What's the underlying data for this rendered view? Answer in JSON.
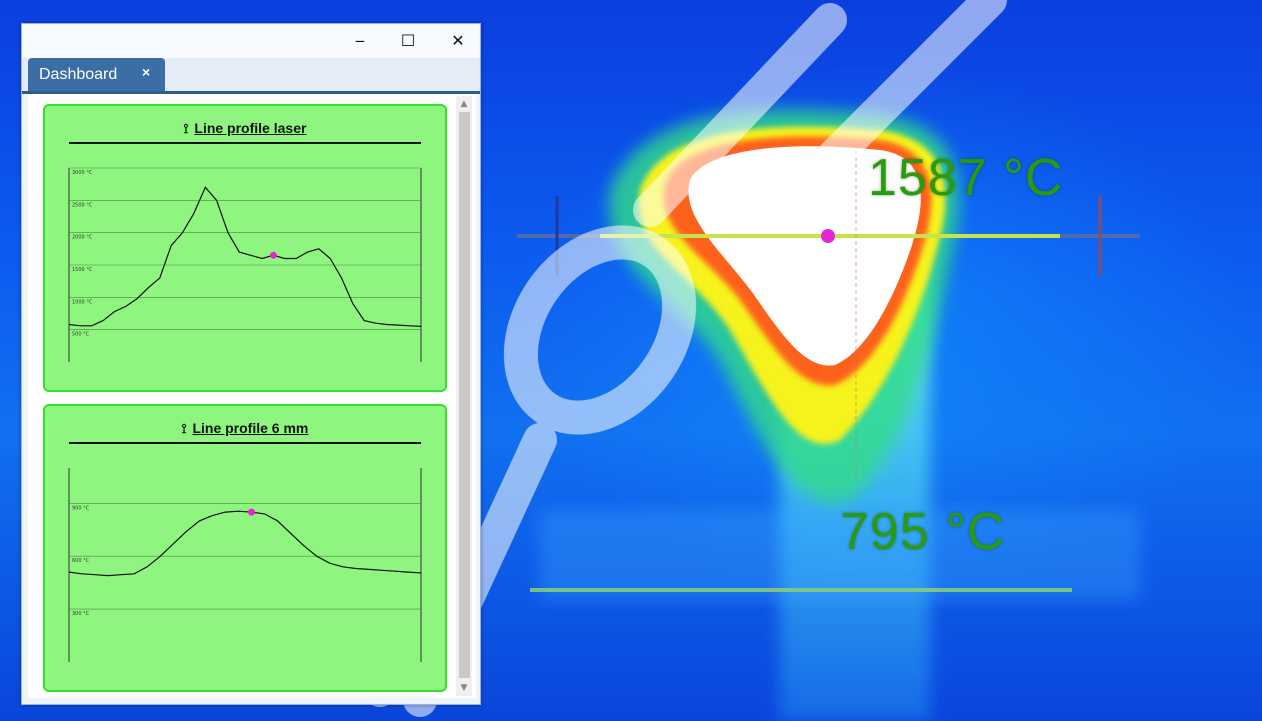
{
  "window": {
    "minimize_label": "‒",
    "maximize_label": "☐",
    "close_label": "✕"
  },
  "tabs": [
    {
      "label": "Dashboard",
      "close_label": "×"
    }
  ],
  "thermal_view": {
    "max_temp_label": "1587 °C",
    "min_temp_label": "795 °C"
  },
  "colors": {
    "panel_fill": "#8ef57f",
    "panel_border": "#35e02d",
    "marker": "#e626d6",
    "tab": "#3a6ea5",
    "temp_label": "#2b9a10"
  },
  "panels": [
    {
      "title": "Line profile laser",
      "icon": "line-profile-icon"
    },
    {
      "title": "Line profile 6 mm",
      "icon": "line-profile-icon"
    }
  ],
  "chart_data": [
    {
      "type": "line",
      "title": "Line profile laser",
      "ylim": [
        0,
        3000
      ],
      "yticks": [
        "3000 °C",
        "2500 °C",
        "2000 °C",
        "1500 °C",
        "1000 °C",
        "500 °C"
      ],
      "ytick_values": [
        3000,
        2500,
        2000,
        1500,
        1000,
        500
      ],
      "grid": true,
      "marker_index": 18,
      "series": [
        {
          "values": [
            580,
            560,
            560,
            640,
            780,
            860,
            980,
            1150,
            1300,
            1800,
            2000,
            2300,
            2700,
            2500,
            2000,
            1700,
            1650,
            1600,
            1650,
            1600,
            1600,
            1700,
            1750,
            1600,
            1300,
            900,
            640,
            600,
            580,
            570,
            560,
            550
          ]
        }
      ]
    },
    {
      "type": "line",
      "title": "Line profile 6 mm",
      "ylim": [
        0,
        1100
      ],
      "yticks": [
        "900 °C",
        "600 °C",
        "300 °C"
      ],
      "ytick_values": [
        900,
        600,
        300
      ],
      "grid": true,
      "marker_index": 14,
      "series": [
        {
          "values": [
            510,
            500,
            495,
            490,
            495,
            500,
            540,
            600,
            670,
            740,
            800,
            830,
            850,
            855,
            850,
            840,
            800,
            730,
            660,
            600,
            560,
            540,
            530,
            525,
            520,
            515,
            510,
            505
          ]
        }
      ]
    }
  ]
}
